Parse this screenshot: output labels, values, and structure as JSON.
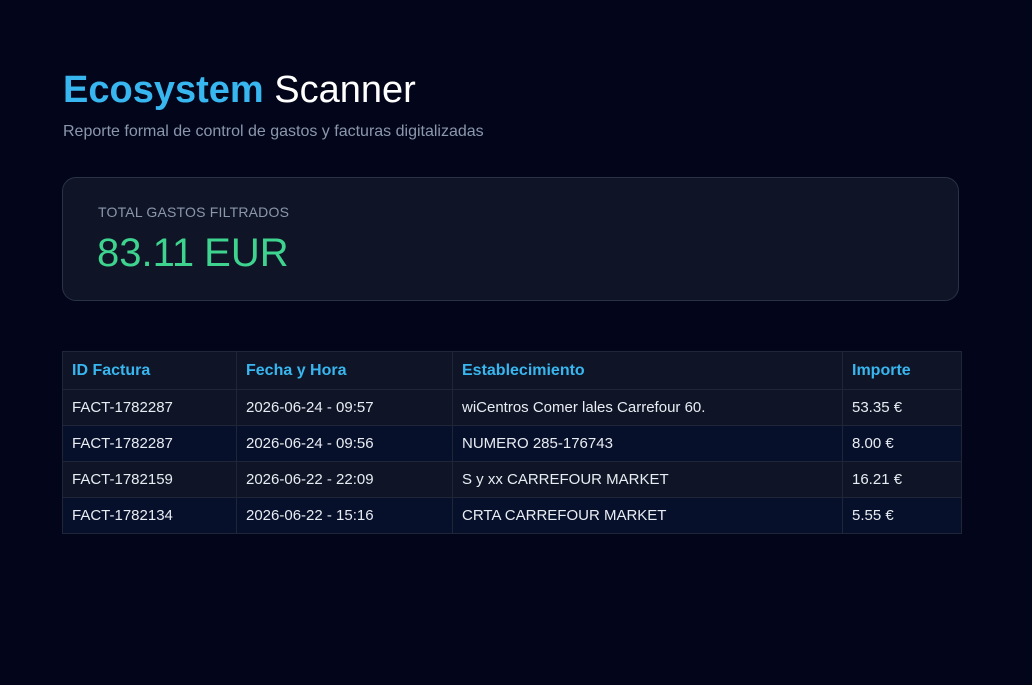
{
  "header": {
    "title_brand": "Ecosystem",
    "title_rest": "Scanner",
    "subtitle": "Reporte formal de control de gastos y facturas digitalizadas"
  },
  "summary": {
    "label": "TOTAL GASTOS FILTRADOS",
    "amount": "83.11",
    "currency": "EUR"
  },
  "table": {
    "columns": [
      "ID Factura",
      "Fecha y Hora",
      "Establecimiento",
      "Importe"
    ],
    "rows": [
      [
        "FACT-1782287",
        "2026-06-24 - 09:57",
        "wiCentros Comer lales Carrefour 60.",
        "53.35 €"
      ],
      [
        "FACT-1782287",
        "2026-06-24 - 09:56",
        "NUMERO  285-176743",
        "8.00 €"
      ],
      [
        "FACT-1782159",
        "2026-06-22 - 22:09",
        "S y xx CARREFOUR MARKET",
        "16.21 €"
      ],
      [
        "FACT-1782134",
        "2026-06-22 - 15:16",
        "CRTA  CARREFOUR MARKET",
        "5.55 €"
      ]
    ]
  },
  "colors": {
    "background": "#03061a",
    "accent": "#38b6f0",
    "total": "#3ed38f",
    "muted": "#8a97ad"
  }
}
